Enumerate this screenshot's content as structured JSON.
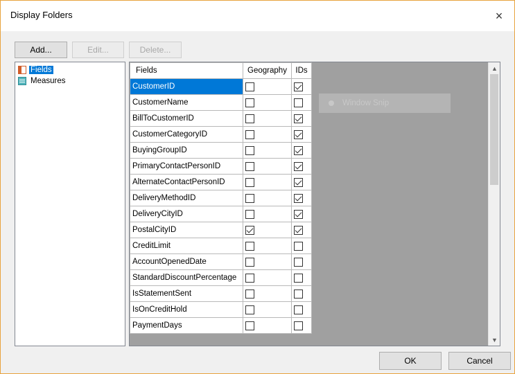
{
  "window": {
    "title": "Display Folders",
    "close_glyph": "×"
  },
  "toolbar": {
    "add_label": "Add...",
    "edit_label": "Edit...",
    "delete_label": "Delete..."
  },
  "tree": {
    "items": [
      {
        "label": "Fields",
        "icon": "table-icon",
        "selected": true
      },
      {
        "label": "Measures",
        "icon": "measures-icon",
        "selected": false
      }
    ]
  },
  "grid": {
    "headers": [
      "Fields",
      "Geography",
      "IDs"
    ],
    "rows": [
      {
        "field": "CustomerID",
        "geography": false,
        "ids": true,
        "selected": true
      },
      {
        "field": "CustomerName",
        "geography": false,
        "ids": false
      },
      {
        "field": "BillToCustomerID",
        "geography": false,
        "ids": true
      },
      {
        "field": "CustomerCategoryID",
        "geography": false,
        "ids": true
      },
      {
        "field": "BuyingGroupID",
        "geography": false,
        "ids": true
      },
      {
        "field": "PrimaryContactPersonID",
        "geography": false,
        "ids": true
      },
      {
        "field": "AlternateContactPersonID",
        "geography": false,
        "ids": true
      },
      {
        "field": "DeliveryMethodID",
        "geography": false,
        "ids": true
      },
      {
        "field": "DeliveryCityID",
        "geography": false,
        "ids": true
      },
      {
        "field": "PostalCityID",
        "geography": true,
        "ids": true
      },
      {
        "field": "CreditLimit",
        "geography": false,
        "ids": false
      },
      {
        "field": "AccountOpenedDate",
        "geography": false,
        "ids": false
      },
      {
        "field": "StandardDiscountPercentage",
        "geography": false,
        "ids": false
      },
      {
        "field": "IsStatementSent",
        "geography": false,
        "ids": false
      },
      {
        "field": "IsOnCreditHold",
        "geography": false,
        "ids": false
      },
      {
        "field": "PaymentDays",
        "geography": false,
        "ids": false
      }
    ]
  },
  "overlay": {
    "snip_label": "Window Snip"
  },
  "footer": {
    "ok_label": "OK",
    "cancel_label": "Cancel"
  }
}
